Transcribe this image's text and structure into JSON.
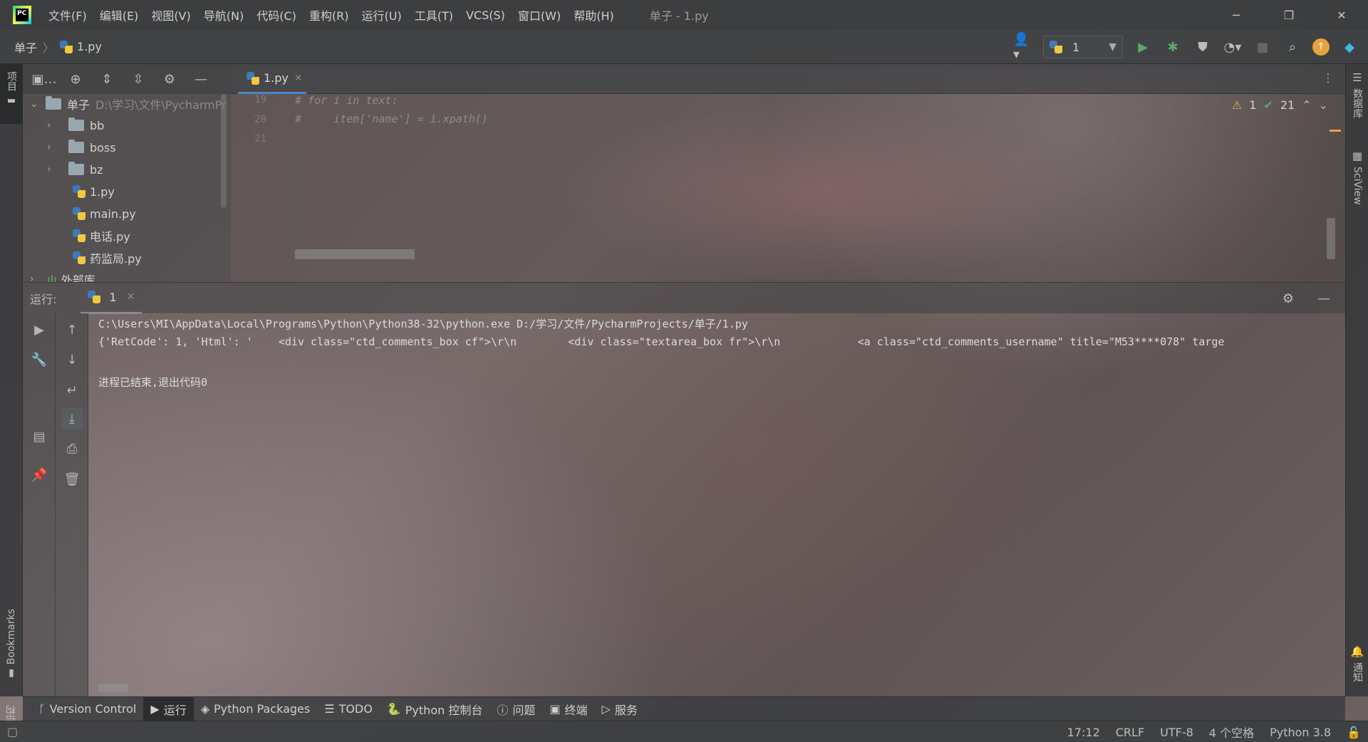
{
  "app": {
    "logo_text": "PC",
    "window_title": "单子 - 1.py"
  },
  "menu": [
    {
      "label": "文件(F)"
    },
    {
      "label": "编辑(E)"
    },
    {
      "label": "视图(V)"
    },
    {
      "label": "导航(N)"
    },
    {
      "label": "代码(C)"
    },
    {
      "label": "重构(R)"
    },
    {
      "label": "运行(U)"
    },
    {
      "label": "工具(T)"
    },
    {
      "label": "VCS(S)"
    },
    {
      "label": "窗口(W)"
    },
    {
      "label": "帮助(H)"
    }
  ],
  "window_controls": {
    "minimize": "─",
    "restore": "❐",
    "close": "✕"
  },
  "navbar": {
    "project": "单子",
    "file": "1.py",
    "run_config": "1"
  },
  "left_stripe": {
    "project_label": "项目",
    "bookmarks_label": "Bookmarks",
    "structure_label": "结构"
  },
  "right_stripe": {
    "database_label": "数据库",
    "sciview_label": "SciView",
    "notifications_label": "通知"
  },
  "project_panel": {
    "root_name": "单子",
    "root_path": "D:\\学习\\文件\\PycharmPr",
    "items": [
      {
        "name": "bb",
        "type": "folder"
      },
      {
        "name": "boss",
        "type": "folder"
      },
      {
        "name": "bz",
        "type": "folder"
      },
      {
        "name": "1.py",
        "type": "python"
      },
      {
        "name": "main.py",
        "type": "python"
      },
      {
        "name": "电话.py",
        "type": "python"
      },
      {
        "name": "药监局.py",
        "type": "python"
      }
    ],
    "external_libs": "外部库"
  },
  "editor": {
    "tab_label": "1.py",
    "lines": [
      {
        "no": "19",
        "text": "# for i in text:"
      },
      {
        "no": "20",
        "text": "#     item['name'] = i.xpath()"
      },
      {
        "no": "21",
        "text": ""
      }
    ],
    "warnings": "1",
    "ok_count": "21"
  },
  "run_panel": {
    "label": "运行:",
    "tab": "1",
    "output": [
      "C:\\Users\\MI\\AppData\\Local\\Programs\\Python\\Python38-32\\python.exe D:/学习/文件/PycharmProjects/单子/1.py",
      "{'RetCode': 1, 'Html': '    <div class=\"ctd_comments_box cf\">\\r\\n        <div class=\"textarea_box fr\">\\r\\n            <a class=\"ctd_comments_username\" title=\"M53****078\" targe",
      "",
      "进程已结束,退出代码0"
    ]
  },
  "tool_windows": [
    {
      "label": "Version Control",
      "icon": "branch-icon"
    },
    {
      "label": "运行",
      "icon": "play-icon"
    },
    {
      "label": "Python Packages",
      "icon": "packages-icon"
    },
    {
      "label": "TODO",
      "icon": "list-icon"
    },
    {
      "label": "Python 控制台",
      "icon": "python-console-icon"
    },
    {
      "label": "问题",
      "icon": "problems-icon"
    },
    {
      "label": "终端",
      "icon": "terminal-icon"
    },
    {
      "label": "服务",
      "icon": "services-icon"
    }
  ],
  "status": {
    "position": "17:12",
    "line_sep": "CRLF",
    "encoding": "UTF-8",
    "indent": "4 个空格",
    "interpreter": "Python 3.8"
  }
}
